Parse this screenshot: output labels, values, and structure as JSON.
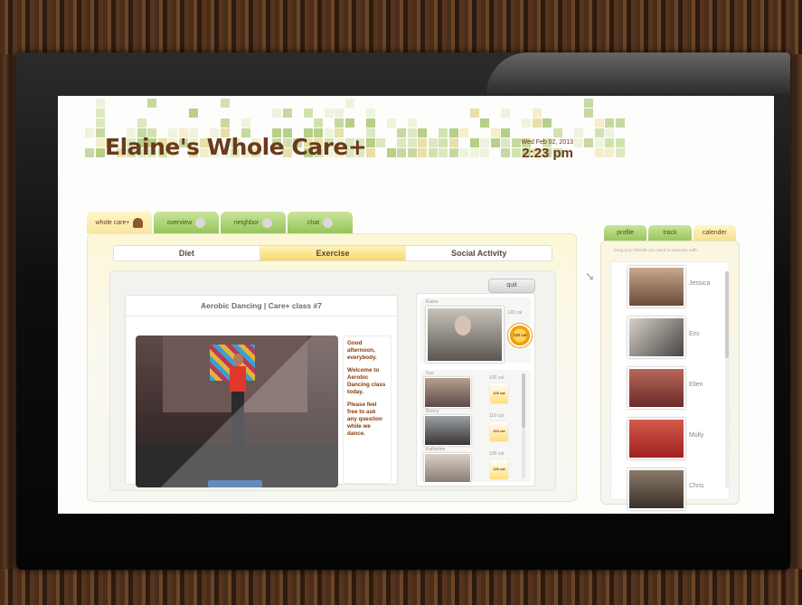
{
  "app": {
    "title": "Elaine's Whole Care+",
    "date": "Wed Feb 02, 2013",
    "time": "2:23 pm"
  },
  "main_tabs": [
    {
      "label": "whole care+",
      "icon": "person-icon",
      "active": true
    },
    {
      "label": "overview",
      "icon": "heart-icon",
      "active": false
    },
    {
      "label": "neighbor",
      "icon": "heart-icon",
      "active": false
    },
    {
      "label": "chat",
      "icon": "chat-icon",
      "active": false
    }
  ],
  "sub_tabs": [
    {
      "label": "Diet",
      "active": false
    },
    {
      "label": "Exercise",
      "active": true
    },
    {
      "label": "Social Activity",
      "active": false
    }
  ],
  "quit_label": "quit",
  "class": {
    "title": "Aerobic Dancing | Care+ class #7",
    "message": [
      "Good afternoon, everybody.",
      "Welcome to Aerobic Dancing class today.",
      "Please feel free to ask any question while we dance."
    ]
  },
  "participants": {
    "self": {
      "name": "Elaine",
      "calories": "120 cal",
      "gauge": "120 cal"
    },
    "others": [
      {
        "name": "Sue",
        "calories": "120 cal",
        "gauge": "120 cal"
      },
      {
        "name": "Ronny",
        "calories": "110 cal",
        "gauge": "110 cal"
      },
      {
        "name": "Katherine",
        "calories": "100 cal",
        "gauge": "100 cal"
      }
    ]
  },
  "sidebar": {
    "tabs": [
      {
        "label": "profile",
        "active": false
      },
      {
        "label": "track",
        "active": false
      },
      {
        "label": "calender",
        "active": true
      }
    ],
    "hint": "Drag your friends you want to exercise with.",
    "friends": [
      "Jessica",
      "Eric",
      "Ellen",
      "Molly",
      "Chris"
    ]
  },
  "colors": {
    "brand_brown": "#6a3a1a",
    "tab_green": "#95c45a",
    "active_yellow": "#f7d86c"
  }
}
